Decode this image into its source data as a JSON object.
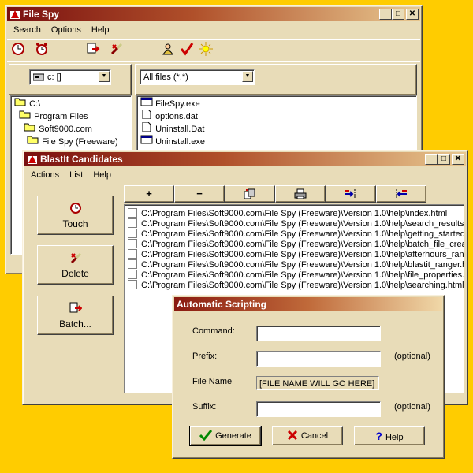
{
  "filespy": {
    "title": "File Spy",
    "menu": [
      "Search",
      "Options",
      "Help"
    ],
    "toolbar_icons": [
      "clock-icon",
      "alarm-clock-icon",
      "batch-icon",
      "delete-brush-icon",
      "user-icon",
      "checkmark-icon",
      "sun-icon"
    ],
    "drive": "c: []",
    "filter": "All files (*.*)",
    "folders": [
      "C:\\",
      "Program Files",
      "Soft9000.com",
      "File Spy (Freeware)"
    ],
    "files": [
      "FileSpy.exe",
      "options.dat",
      "Uninstall.Dat",
      "Uninstall.exe"
    ]
  },
  "blastit": {
    "title": "BlastIt Candidates",
    "menu": [
      "Actions",
      "List",
      "Help"
    ],
    "buttons": {
      "touch": "Touch",
      "delete": "Delete",
      "batch": "Batch..."
    },
    "toolbar": [
      "+",
      "−",
      "",
      "",
      "",
      ""
    ],
    "files": [
      "C:\\Program Files\\Soft9000.com\\File Spy (Freeware)\\Version 1.0\\help\\index.html",
      "C:\\Program Files\\Soft9000.com\\File Spy (Freeware)\\Version 1.0\\help\\search_results.htm",
      "C:\\Program Files\\Soft9000.com\\File Spy (Freeware)\\Version 1.0\\help\\getting_started.h",
      "C:\\Program Files\\Soft9000.com\\File Spy (Freeware)\\Version 1.0\\help\\batch_file_creatio",
      "C:\\Program Files\\Soft9000.com\\File Spy (Freeware)\\Version 1.0\\help\\afterhours_range",
      "C:\\Program Files\\Soft9000.com\\File Spy (Freeware)\\Version 1.0\\help\\blastit_ranger.htm",
      "C:\\Program Files\\Soft9000.com\\File Spy (Freeware)\\Version 1.0\\help\\file_properties.htm",
      "C:\\Program Files\\Soft9000.com\\File Spy (Freeware)\\Version 1.0\\help\\searching.html"
    ]
  },
  "scripting": {
    "title": "Automatic Scripting",
    "labels": {
      "command": "Command:",
      "prefix": "Prefix:",
      "file_name": "File Name",
      "suffix": "Suffix:"
    },
    "optional": "(optional)",
    "command_value": "",
    "prefix_value": "",
    "file_name_value": "[FILE NAME WILL GO HERE]",
    "suffix_value": "",
    "buttons": {
      "generate": "Generate",
      "cancel": "Cancel",
      "help": "Help"
    }
  },
  "colors": {
    "desktop": "#ffcc00",
    "window": "#e8dcb8",
    "title_dark": "#7a1010",
    "title_light": "#e8c890"
  }
}
